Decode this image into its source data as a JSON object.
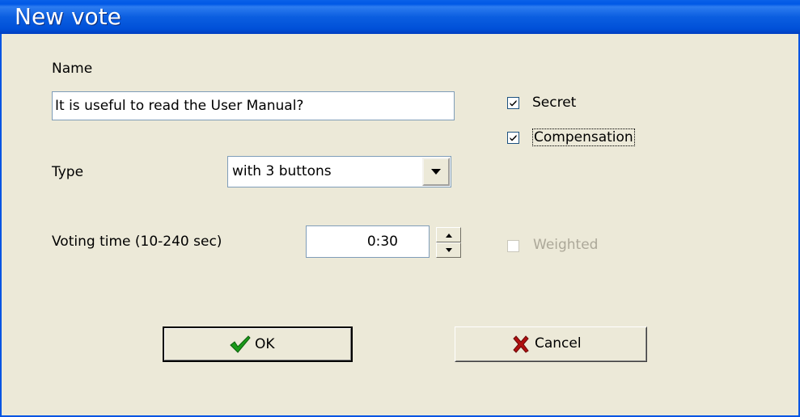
{
  "window": {
    "title": "New vote"
  },
  "name": {
    "label": "Name",
    "value": "It is useful to read the User Manual?"
  },
  "options": {
    "secret": {
      "label": "Secret",
      "checked": true
    },
    "compensation": {
      "label": "Compensation",
      "checked": true
    },
    "weighted": {
      "label": "Weighted",
      "checked": false,
      "enabled": false
    }
  },
  "type": {
    "label": "Type",
    "selected": "with 3 buttons"
  },
  "voting_time": {
    "label": "Voting time (10-240 sec)",
    "value": "0:30"
  },
  "buttons": {
    "ok": "OK",
    "cancel": "Cancel"
  },
  "icons": {
    "ok": "green-checkmark-icon",
    "cancel": "red-x-icon",
    "dropdown": "triangle-down-icon",
    "spin_up": "triangle-up-icon",
    "spin_down": "triangle-down-icon"
  },
  "colors": {
    "titlebar": "#0058e6",
    "dialog_bg": "#ece9d8",
    "ok_icon": "#1a9a1a",
    "cancel_icon": "#b01010"
  }
}
